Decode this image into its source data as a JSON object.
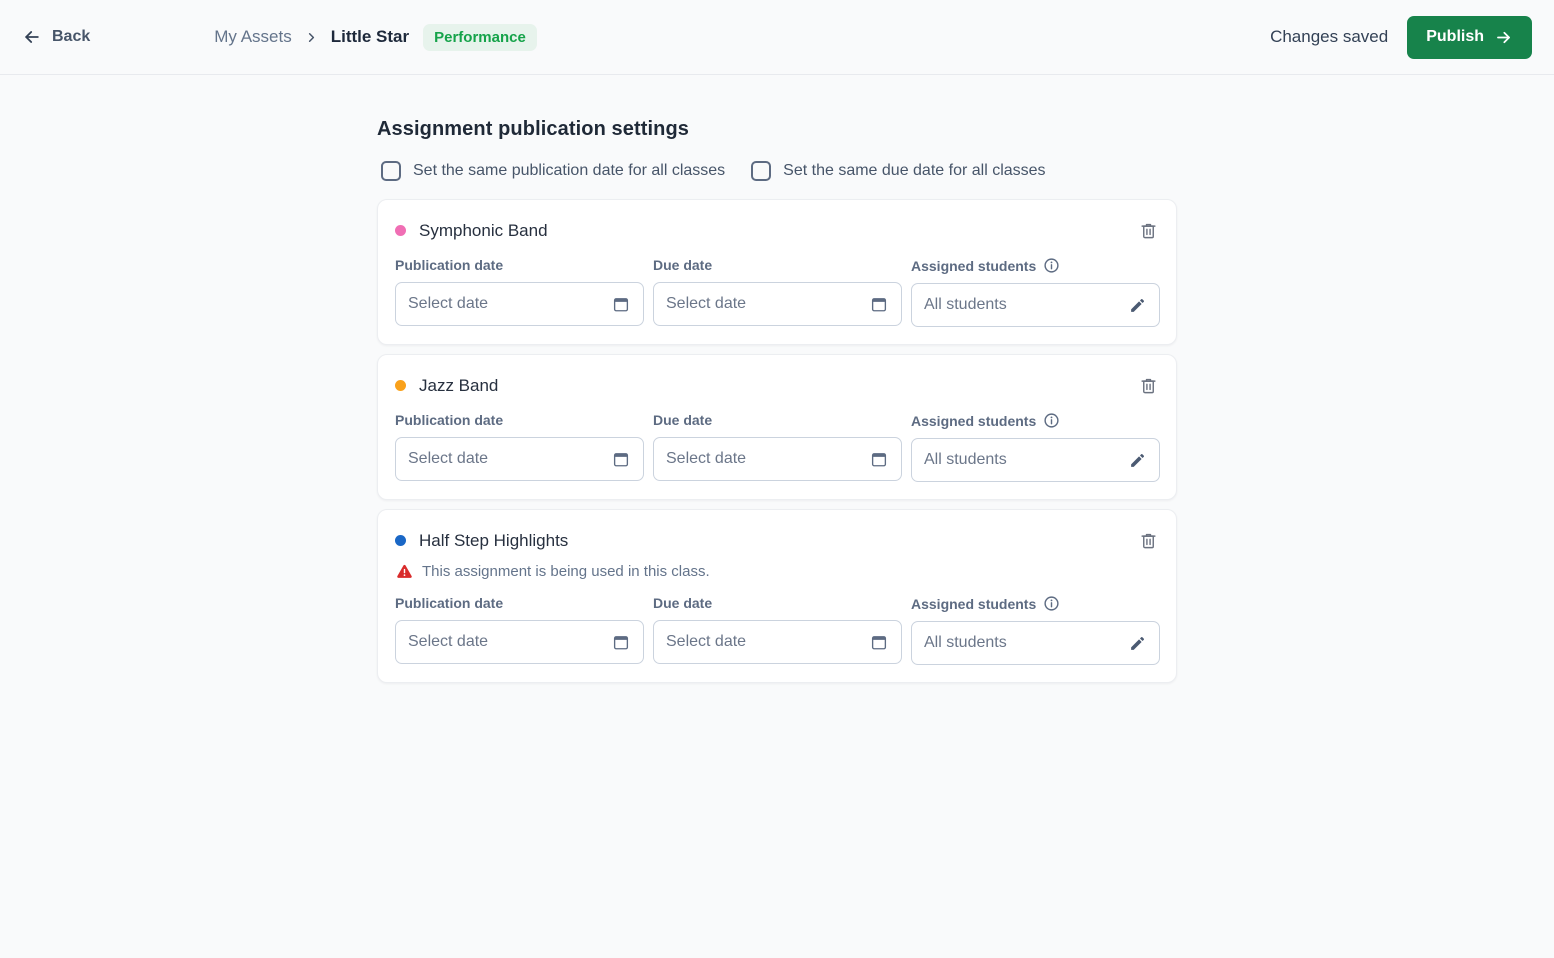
{
  "colors": {
    "publish_green": "#17834b",
    "badge_bg": "#e7f3ec",
    "badge_text": "#16a34a",
    "warning_red": "#d92c2c"
  },
  "header": {
    "back_label": "Back",
    "breadcrumb": {
      "parent": "My Assets",
      "current": "Little Star"
    },
    "badge_label": "Performance",
    "status_text": "Changes saved",
    "publish_label": "Publish"
  },
  "main": {
    "title": "Assignment publication settings",
    "checkboxes": [
      {
        "label": "Set the same publication date for all classes",
        "checked": false
      },
      {
        "label": "Set the same due date for all classes",
        "checked": false
      }
    ],
    "field_labels": {
      "publication_date": "Publication date",
      "due_date": "Due date",
      "assigned_students": "Assigned students"
    },
    "classes": [
      {
        "name": "Symphonic Band",
        "dot_color": "#f06eb4",
        "publication_date": "Select date",
        "due_date": "Select date",
        "assigned_students": "All students"
      },
      {
        "name": "Jazz Band",
        "dot_color": "#f9a11b",
        "publication_date": "Select date",
        "due_date": "Select date",
        "assigned_students": "All students"
      },
      {
        "name": "Half Step Highlights",
        "dot_color": "#1a67c6",
        "warning": "This assignment is being used in this class.",
        "publication_date": "Select date",
        "due_date": "Select date",
        "assigned_students": "All students"
      }
    ]
  }
}
